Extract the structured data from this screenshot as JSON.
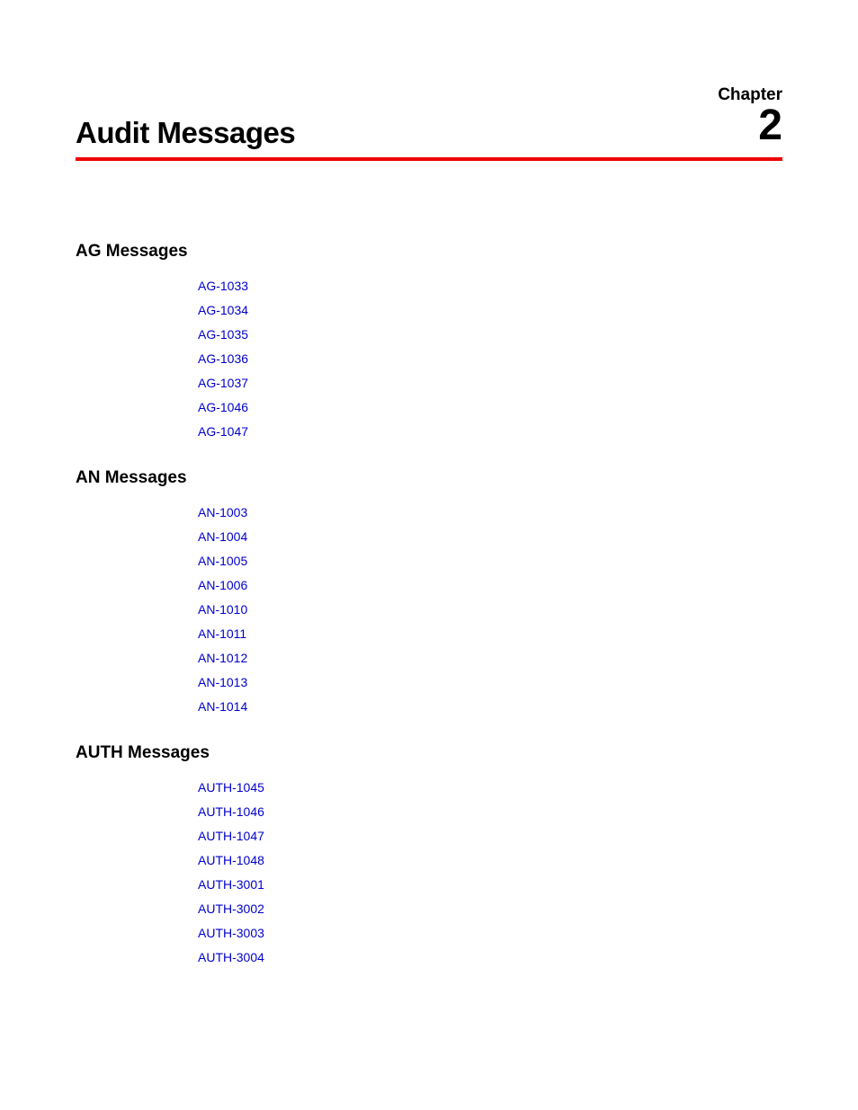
{
  "chapter": {
    "title": "Audit Messages",
    "label": "Chapter",
    "number": "2"
  },
  "sections": [
    {
      "heading": "AG Messages",
      "links": [
        "AG-1033",
        "AG-1034",
        "AG-1035",
        "AG-1036",
        "AG-1037",
        "AG-1046",
        "AG-1047"
      ]
    },
    {
      "heading": "AN Messages",
      "links": [
        "AN-1003",
        "AN-1004",
        "AN-1005",
        "AN-1006",
        "AN-1010",
        "AN-1011",
        "AN-1012",
        "AN-1013",
        "AN-1014"
      ]
    },
    {
      "heading": "AUTH Messages",
      "links": [
        "AUTH-1045",
        "AUTH-1046",
        "AUTH-1047",
        "AUTH-1048",
        "AUTH-3001",
        "AUTH-3002",
        "AUTH-3003",
        "AUTH-3004"
      ]
    }
  ]
}
